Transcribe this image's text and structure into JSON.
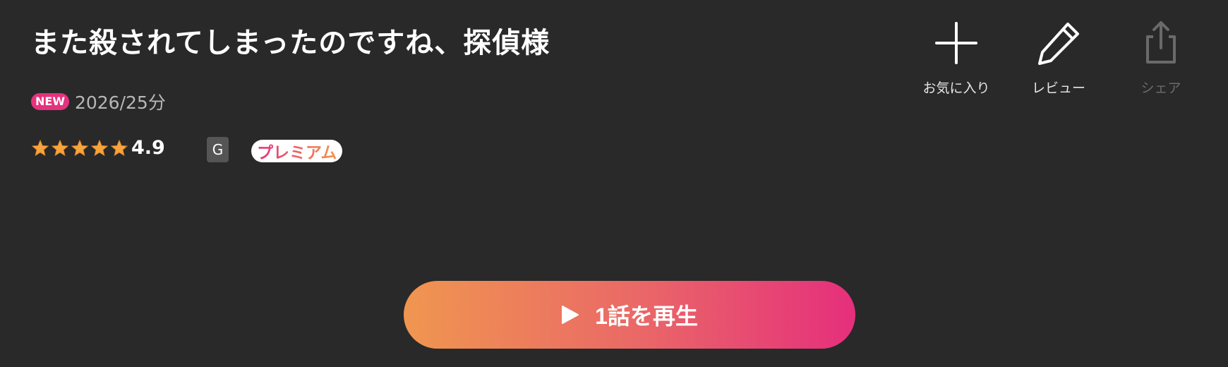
{
  "title": "また殺されてしまったのですね、探偵様",
  "meta": {
    "new_badge": "NEW",
    "info": "2026/25分"
  },
  "rating": {
    "score": "4.9",
    "stars_value": 4.9,
    "stars_max": 5,
    "star_color": "#f7a43a"
  },
  "age_rating": "G",
  "premium_label": "プレミアム",
  "actions": [
    {
      "label": "お気に入り",
      "icon": "plus-icon",
      "enabled": true
    },
    {
      "label": "レビュー",
      "icon": "pencil-icon",
      "enabled": true
    },
    {
      "label": "シェア",
      "icon": "share-icon",
      "enabled": false
    }
  ],
  "play_button": {
    "label": "1話を再生",
    "icon": "play-icon"
  },
  "colors": {
    "background": "#292929",
    "accent_pink": "#e5327c",
    "accent_orange": "#f09650"
  }
}
